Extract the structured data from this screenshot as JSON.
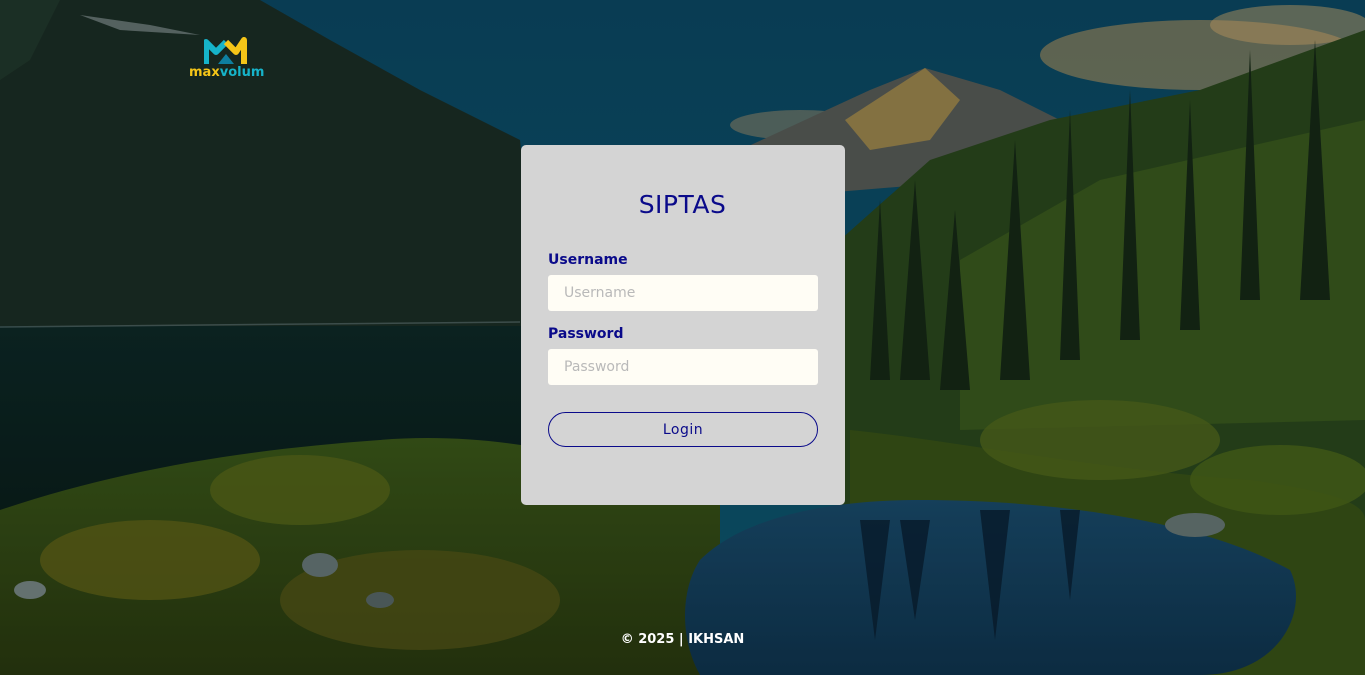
{
  "brand": {
    "logo_part1": "max",
    "logo_part2": "volum"
  },
  "login_card": {
    "title": "SIPTAS",
    "username_label": "Username",
    "username_placeholder": "Username",
    "username_value": "",
    "password_label": "Password",
    "password_placeholder": "Password",
    "password_value": "",
    "login_label": "Login"
  },
  "footer": {
    "text": "© 2025 | IKHSAN"
  },
  "colors": {
    "accent": "#0a0a8a",
    "card_bg": "#d4d4d4",
    "input_bg": "#fffdf5",
    "logo_yellow": "#f5c518",
    "logo_teal": "#16b3c9"
  },
  "icons": {
    "logo": "maxvolum-m-logo"
  }
}
